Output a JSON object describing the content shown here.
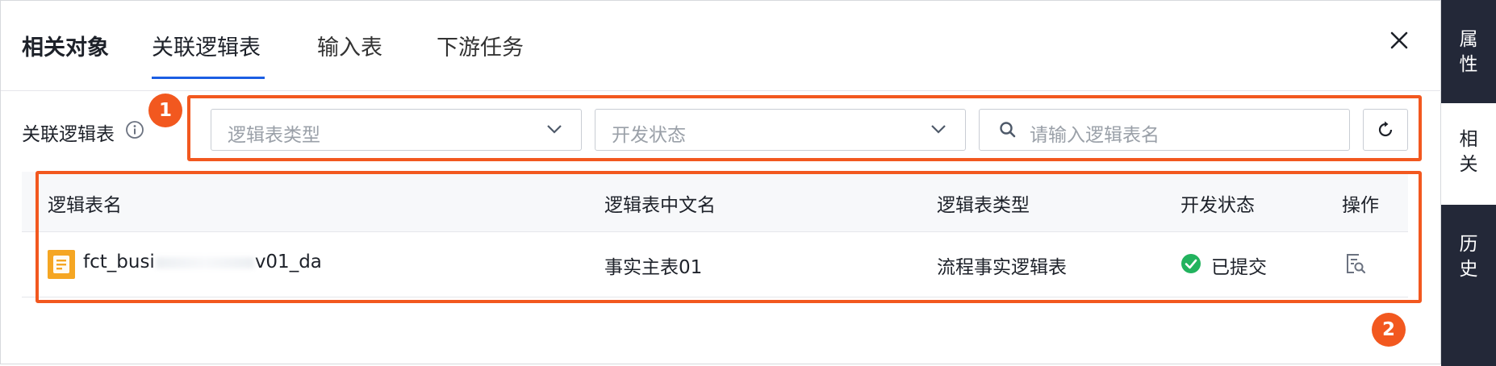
{
  "tabs": {
    "title": "相关对象",
    "active": "关联逻辑表",
    "input": "输入表",
    "downstream": "下游任务"
  },
  "filter": {
    "label": "关联逻辑表",
    "type_placeholder": "逻辑表类型",
    "status_placeholder": "开发状态",
    "search_placeholder": "请输入逻辑表名"
  },
  "table": {
    "headers": [
      "逻辑表名",
      "逻辑表中文名",
      "逻辑表类型",
      "开发状态",
      "操作"
    ],
    "rows": [
      {
        "name_start": "fct_busi",
        "name_end": "v01_da",
        "cn_name": "事实主表01",
        "type": "流程事实逻辑表",
        "status": "已提交"
      }
    ]
  },
  "annotations": {
    "badge1": "1",
    "badge2": "2",
    "color": "#f2581f"
  },
  "sidebar": {
    "tabs": [
      {
        "line1": "属",
        "line2": "性"
      },
      {
        "line1": "相",
        "line2": "关"
      },
      {
        "line1": "历",
        "line2": "史"
      }
    ]
  },
  "icons": [
    "close-icon",
    "info-icon",
    "chevron-down-icon",
    "search-icon",
    "refresh-icon",
    "file-icon",
    "check-circle-icon",
    "view-detail-icon"
  ],
  "colors": {
    "accent": "#1b5ee3",
    "success": "#22b35e",
    "file": "#f5a623",
    "sidebar_bg": "#232838"
  }
}
